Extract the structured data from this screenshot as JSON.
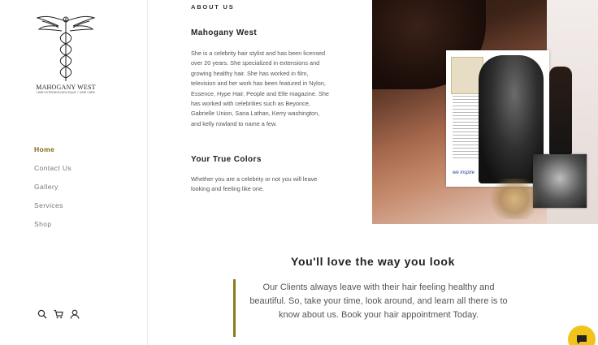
{
  "brand": {
    "name": "MAHOGANY WEST",
    "tagline": "HAIR EXTENSION BOUTIQUE + HAIR CARE"
  },
  "nav": {
    "items": [
      {
        "label": "Home",
        "active": true
      },
      {
        "label": "Contact Us",
        "active": false
      },
      {
        "label": "Gallery",
        "active": false
      },
      {
        "label": "Services",
        "active": false
      },
      {
        "label": "Shop",
        "active": false
      }
    ]
  },
  "toolbar": {
    "icons": [
      "search-icon",
      "cart-icon",
      "account-icon"
    ]
  },
  "about": {
    "eyebrow": "ABOUT US",
    "title": "Mahogany West",
    "body": "She is a celebrity hair stylist and has been licensed over 20 years. She specialized in extensions and growing healthy hair. She has worked in film, television and her work has been featured in Nylon, Essence, Hype Hair, People and Elle magazine. She has worked with celebrities such as Beyonce, Gabrielle Union, Sana Lathan, Kerry washington, and kelly rowland to name a few.",
    "colors_title": "Your True Colors",
    "colors_body": "Whether you are a celebrity or not you will leave looking and feeling like one."
  },
  "hero": {
    "collage_logo": "we inspire"
  },
  "love": {
    "title": "You'll love the way you look",
    "quote": "Our Clients always leave with their hair feeling healthy and beautiful. So, take your time, look around, and learn all there is to know about us. Book your hair appointment Today."
  },
  "colors": {
    "accent": "#7c6a12",
    "quote_bar": "#8b7a1e",
    "chat": "#f2c31a"
  }
}
